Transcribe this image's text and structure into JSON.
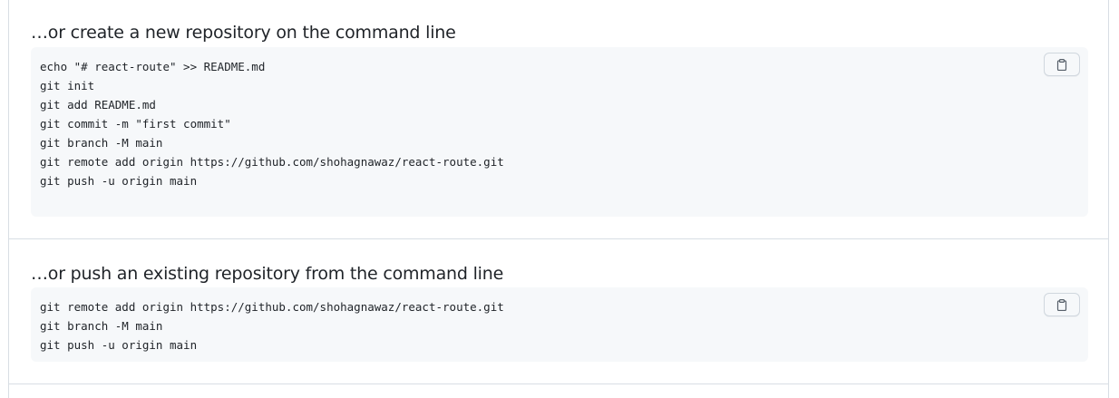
{
  "colors": {
    "code_background": "#f6f8fa",
    "border": "#d8dee4",
    "text": "#1f2328",
    "icon": "#57606a"
  },
  "create_section": {
    "heading": "…or create a new repository on the command line",
    "lines": [
      "echo \"# react-route\" >> README.md",
      "git init",
      "git add README.md",
      "git commit -m \"first commit\"",
      "git branch -M main",
      "git remote add origin https://github.com/shohagnawaz/react-route.git",
      "git push -u origin main"
    ],
    "copy_icon": "clipboard-icon"
  },
  "push_section": {
    "heading": "…or push an existing repository from the command line",
    "lines": [
      "git remote add origin https://github.com/shohagnawaz/react-route.git",
      "git branch -M main",
      "git push -u origin main"
    ],
    "copy_icon": "clipboard-icon"
  }
}
